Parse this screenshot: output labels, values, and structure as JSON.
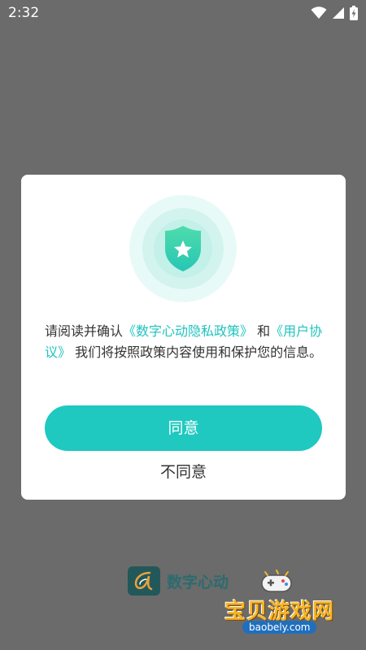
{
  "status_bar": {
    "time": "2:32",
    "icons": [
      "wifi-icon",
      "signal-icon",
      "battery-charging-icon"
    ]
  },
  "dialog": {
    "badge_icon": "shield-star-icon",
    "message": {
      "part1": "请阅读并确认",
      "link1": "《数字心动隐私政策》",
      "part2": "和",
      "link2": "《用户协议》",
      "part3": "我们将按照政策内容使用和保护您的信息。"
    },
    "agree_label": "同意",
    "disagree_label": "不同意"
  },
  "brand": {
    "logo_icon": "app-logo-icon",
    "name": "数字心动"
  },
  "watermark": {
    "title": "宝贝游戏网",
    "url": "baobely.com",
    "icon": "gamepad-icon"
  },
  "colors": {
    "accent": "#1fc9c0",
    "link": "#1fc3be",
    "backdrop": "#6b6b6b"
  }
}
